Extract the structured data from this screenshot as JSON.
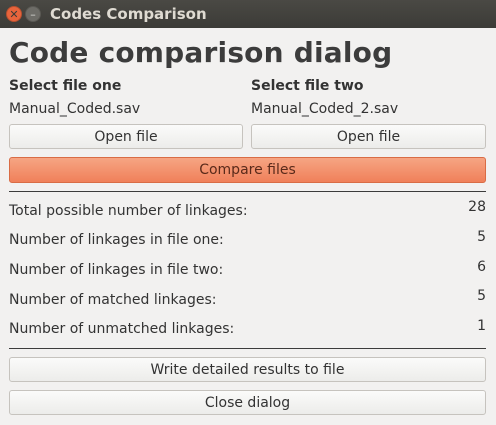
{
  "window": {
    "title": "Codes Comparison"
  },
  "heading": "Code comparison dialog",
  "file_one": {
    "label": "Select file one",
    "filename": "Manual_Coded.sav",
    "open_label": "Open file"
  },
  "file_two": {
    "label": "Select file two",
    "filename": "Manual_Coded_2.sav",
    "open_label": "Open file"
  },
  "compare_label": "Compare files",
  "stats": [
    {
      "label": "Total possible number of linkages:",
      "value": "28"
    },
    {
      "label": "Number of linkages in file one:",
      "value": "5"
    },
    {
      "label": "Number of linkages in file two:",
      "value": "6"
    },
    {
      "label": "Number of matched linkages:",
      "value": "5"
    },
    {
      "label": "Number of unmatched linkages:",
      "value": "1"
    }
  ],
  "write_label": "Write detailed results to file",
  "close_label": "Close dialog",
  "icons": {
    "close": "close-icon",
    "minimize": "minimize-icon"
  },
  "colors": {
    "accent": "#f0805a",
    "titlebar": "#3c3b37"
  }
}
